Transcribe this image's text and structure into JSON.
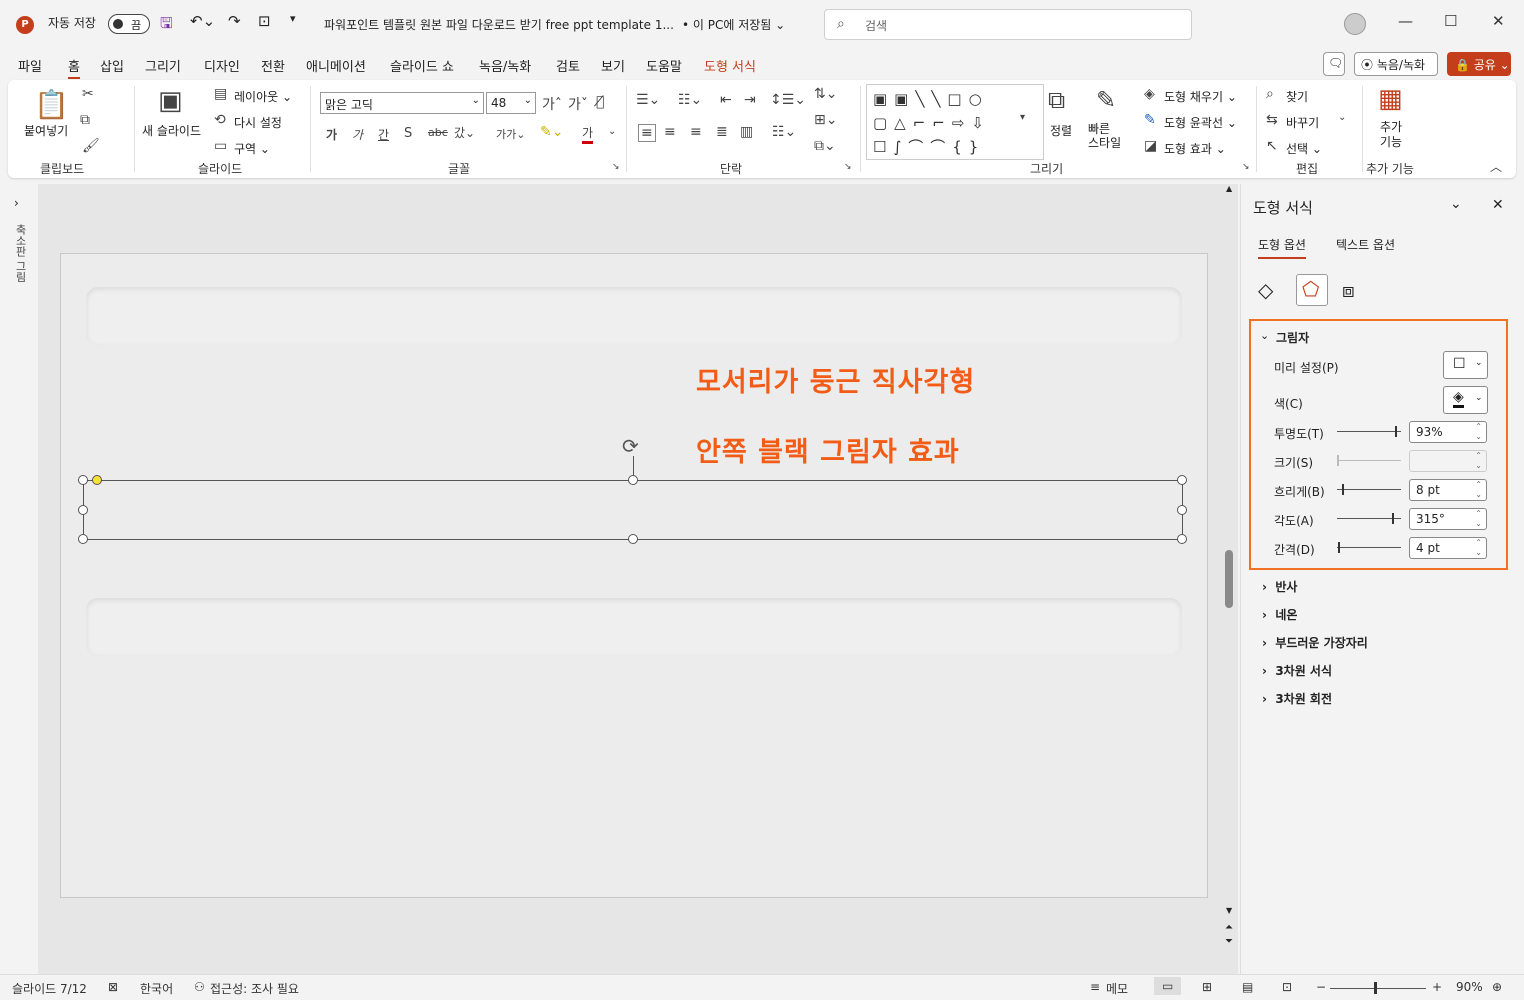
{
  "titlebar": {
    "autosave_label": "자동 저장",
    "autosave_state": "끔",
    "doc_title": "파워포인트 템플릿 원본 파일 다운로드 받기 free ppt template 1...",
    "save_state": "• 이 PC에 저장됨 ⌄",
    "search_placeholder": "검색"
  },
  "menu": [
    "파일",
    "홈",
    "삽입",
    "그리기",
    "디자인",
    "전환",
    "애니메이션",
    "슬라이드 쇼",
    "녹음/녹화",
    "검토",
    "보기",
    "도움말",
    "도형 서식"
  ],
  "topbuttons": {
    "record": "⦿ 녹음/녹화",
    "share": "🔒 공유 ⌄"
  },
  "ribbon": {
    "clipboard": {
      "paste": "붙여넣기",
      "label": "클립보드"
    },
    "slides": {
      "new": "새 슬라이드",
      "layout": "레이아웃 ⌄",
      "reset": "다시 설정",
      "section": "구역 ⌄",
      "label": "슬라이드"
    },
    "font": {
      "name": "맑은 고딕",
      "size": "48",
      "label": "글꼴"
    },
    "paragraph": {
      "label": "단락"
    },
    "drawing": {
      "arrange": "정렬",
      "quick_styles": "빠른\n스타일",
      "fill": "도형 채우기 ⌄",
      "outline": "도형 윤곽선 ⌄",
      "effects": "도형 효과 ⌄",
      "label": "그리기"
    },
    "edit": {
      "find": "찾기",
      "replace": "바꾸기",
      "select": "선택 ⌄",
      "label": "편집"
    },
    "addins": {
      "btn": "추가\n기능",
      "label": "추가 기능"
    }
  },
  "leftpane": {
    "label": "축소판 그림"
  },
  "slide": {
    "line1": "모서리가 둥근 직사각형",
    "line2": "안쪽 블랙 그림자 효과"
  },
  "pane": {
    "title": "도형 서식",
    "tab_shape": "도형 옵션",
    "tab_text": "텍스트 옵션",
    "shadow": {
      "title": "그림자",
      "preset": "미리 설정(P)",
      "color": "색(C)",
      "transparency": "투명도(T)",
      "transparency_value": "93%",
      "transparency_level": 0.93,
      "size": "크기(S)",
      "blur": "흐리게(B)",
      "blur_value": "8 pt",
      "angle": "각도(A)",
      "angle_value": "315°",
      "distance": "간격(D)",
      "distance_value": "4 pt"
    },
    "sections": [
      "반사",
      "네온",
      "부드러운 가장자리",
      "3차원 서식",
      "3차원 회전"
    ]
  },
  "status": {
    "slide": "슬라이드 7/12",
    "lang": "한국어",
    "access": "접근성: 조사 필요",
    "notes": "메모",
    "zoom": "90%"
  },
  "colors": {
    "accent": "#c43e1c",
    "highlight": "#f07125",
    "slide_text": "#f25c16"
  }
}
